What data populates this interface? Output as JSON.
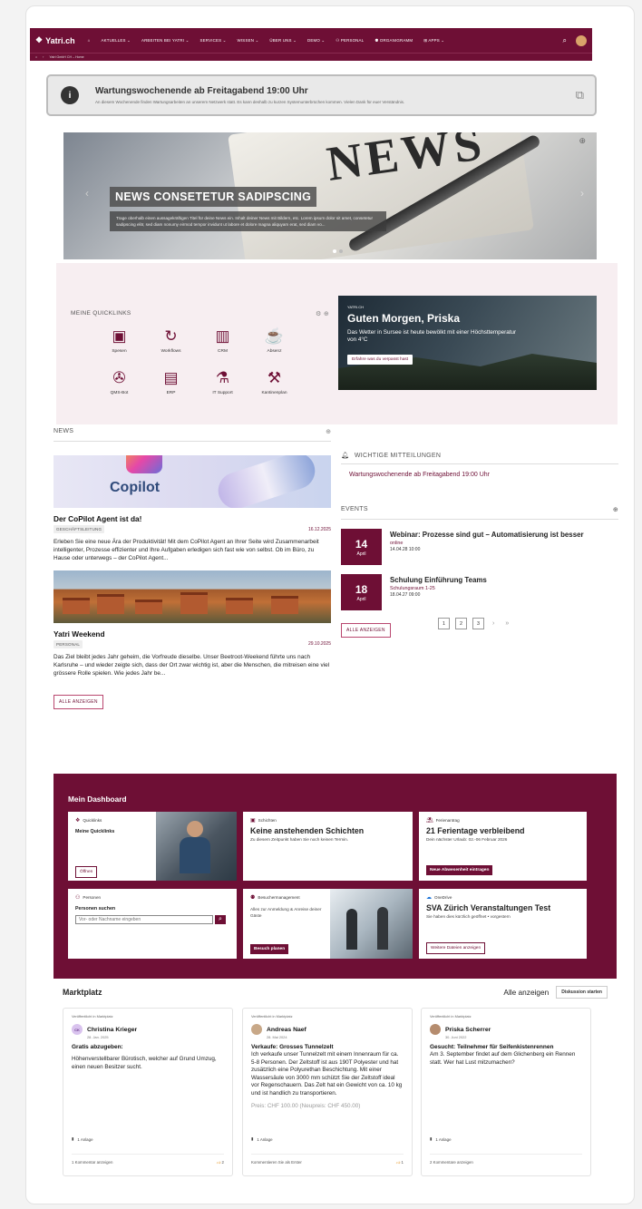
{
  "brand": {
    "name": "Yatri.ch"
  },
  "topnav": {
    "items": [
      "AKTUELLES ⌄",
      "ARBEITEN BEI YATRI ⌄",
      "SERVICES ⌄",
      "WISSEN ⌄",
      "ÜBER UNS ⌄",
      "DEMO ⌄",
      "PERSONAL",
      "ORGANIGRAMM",
      "APPS ⌄"
    ],
    "breadcrumb": "Yatri GmbH CH – Home"
  },
  "alert": {
    "title": "Wartungswochenende ab Freitagabend 19:00 Uhr",
    "text": "An diesem Wochenende finden Wartungsarbeiten an unserem Netzwerk statt. Es kann deshalb zu kurzen Systemunterbrüchen kommen. Vielen Dank für euer Verständnis."
  },
  "hero": {
    "title": "NEWS CONSETETUR SADIPSCING",
    "text": "Trage oberhalb einen aussagekräftigen Titel für deine News ein. Inhalt deiner News mit Bildern, etc. Lorem ipsum dolor sit amet, consetetur sadipscing elitr, sed diam nonumy eirmod tempor invidunt ut labore et dolore magna aliquyam erat, sed diam vo..."
  },
  "quicklinks": {
    "header": "MEINE QUICKLINKS",
    "items": [
      {
        "label": "Spesen",
        "icon": "receipt-icon"
      },
      {
        "label": "Workflows",
        "icon": "workflow-icon"
      },
      {
        "label": "CRM",
        "icon": "crm-icon"
      },
      {
        "label": "Absenz",
        "icon": "cup-icon"
      },
      {
        "label": "QMS-Bot",
        "icon": "bot-icon"
      },
      {
        "label": "ERP",
        "icon": "erp-icon"
      },
      {
        "label": "IT Support",
        "icon": "support-icon"
      },
      {
        "label": "Kantinenplan",
        "icon": "canteen-icon"
      }
    ]
  },
  "greeting": {
    "site": "YATRI.CH",
    "title": "Guten Morgen, Priska",
    "text": "Das Wetter in Sursee ist heute bewölkt mit einer Höchsttemperatur von 4°C",
    "button": "Erfahre was du verpasst hast"
  },
  "news": {
    "header": "NEWS",
    "articles": [
      {
        "title": "Der CoPilot Agent ist da!",
        "tag": "GESCHÄFTSLEITUNG",
        "date": "16.12.2025",
        "body": "Erleben Sie eine neue Ära der Produktivität! Mit dem CoPilot Agent an Ihrer Seite wird Zusammenarbeit intelligenter, Prozesse effizienter und Ihre Aufgaben erledigen sich fast wie von selbst. Ob im Büro, zu Hause oder unterwegs – der CoPilot Agent...",
        "image_text": "Copilot"
      },
      {
        "title": "Yatri Weekend",
        "tag": "PERSONAL",
        "date": "29.10.2025",
        "body": "Das Ziel bleibt jedes Jahr geheim, die Vorfreude dieselbe. Unser Beetroot-Weekend führte uns nach Karlsruhe – und wieder zeigte sich, dass der Ort zwar wichtig ist, aber die Menschen, die mitreisen eine viel grössere Rolle spielen. Wie jedes Jahr be..."
      }
    ],
    "button": "ALLE ANZEIGEN"
  },
  "announcements": {
    "header": "WICHTIGE MITTEILUNGEN",
    "link": "Wartungswochenende ab Freitagabend 19:00 Uhr"
  },
  "events": {
    "header": "EVENTS",
    "items": [
      {
        "day": "14",
        "month": "April",
        "title": "Webinar: Prozesse sind gut – Automatisierung ist besser",
        "location": "online",
        "time": "14.04.28 10:00"
      },
      {
        "day": "18",
        "month": "April",
        "title": "Schulung Einführung Teams",
        "location": "Schulungsraum 1-25",
        "time": "18.04.27 09:00"
      }
    ],
    "button": "ALLE ANZEIGEN",
    "pages": [
      "1",
      "2",
      "3"
    ],
    "next": "›",
    "last": "»"
  },
  "dashboard": {
    "title": "Mein Dashboard",
    "quicklinks": {
      "label": "Quicklinks",
      "sub": "Meine Quicklinks",
      "button": "Öffnen"
    },
    "shifts": {
      "label": "Schichten",
      "title": "Keine anstehenden Schichten",
      "text": "Zu diesem Zeitpunkt haben Sie noch keinen Termin."
    },
    "vacation": {
      "label": "Ferienantrag",
      "title": "21 Ferientage verbleibend",
      "text": "Dein nächster Urlaub: 02.-06 Februar 2026",
      "button": "Neue Abwesenheit eintragen"
    },
    "people": {
      "label": "Personen",
      "sub": "Personen suchen",
      "placeholder": "Vor- oder Nachname eingeben"
    },
    "visitors": {
      "label": "Besuchermanagement",
      "text": "Alles zur Anmeldung & Anreise deiner Gäste",
      "button": "Besuch planen"
    },
    "onedrive": {
      "label": "OneDrive",
      "title": "SVA Zürich Veranstaltungen Test",
      "text": "Sie haben dies kürzlich geöffnet • vorgestern",
      "button": "Weitere Dateien anzeigen"
    }
  },
  "market": {
    "title": "Marktplatz",
    "all": "Alle anzeigen",
    "discuss": "Diskussion starten",
    "posts": [
      {
        "published": "Veröffentlicht in Marktplatz",
        "initials": "CK",
        "name": "Christina Krieger",
        "date": "28. Jan. 2025",
        "heading": "Gratis abzugeben:",
        "body": "Höhenverstellbarer Bürotisch, welcher auf Grund Umzug, einen neuen Besitzer sucht.",
        "price": "",
        "attachment": "1 Anlage",
        "comments": "1 Kommentar anzeigen",
        "likes": "2"
      },
      {
        "published": "Veröffentlicht in Marktplatz",
        "initials": "AN",
        "name": "Andreas Naef",
        "date": "28. Mai 2024",
        "heading": "Verkaufe: Grosses Tunnelzelt",
        "body": "Ich verkaufe unser Tunnelzelt mit einem Innenraum für ca. 5-8 Personen. Der Zeltstoff ist aus 190T Polyester und hat zusätzlich eine Polyurethan Beschichtung. Mit einer Wassersäule von 3000 mm schützt Sie der Zeltstoff ideal vor Regenschauern. Das Zelt hat ein Gewicht von ca. 10 kg und ist handlich zu transportieren.",
        "price": "Preis: CHF 100.00 (Neupreis: CHF 450.00)",
        "attachment": "1 Anlage",
        "comments": "Kommentieren Sie als Erster",
        "likes": "1"
      },
      {
        "published": "Veröffentlicht in Marktplatz",
        "initials": "PS",
        "name": "Priska Scherrer",
        "date": "30. Juni 2022",
        "heading": "Gesucht: Teilnehmer für Seifenkistenrennen",
        "body": "Am 3. September findet auf dem Glichenberg ein Rennen statt. Wer hat Lust mitzumachen?",
        "price": "",
        "attachment": "1 Anlage",
        "comments": "2 Kommentare anzeigen",
        "likes": ""
      }
    ]
  },
  "colors": {
    "accent": "#6e0f35",
    "band": "#f7eef1"
  }
}
